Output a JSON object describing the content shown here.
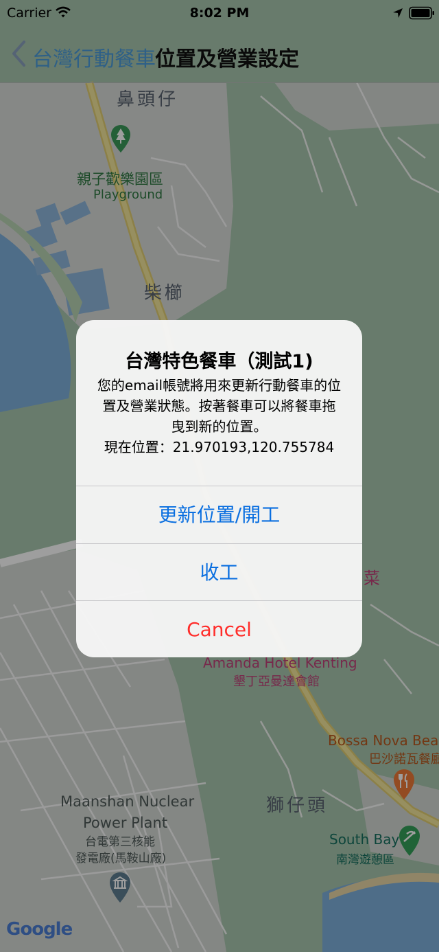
{
  "status_bar": {
    "carrier": "Carrier",
    "time": "8:02 PM"
  },
  "nav": {
    "back_label": "台灣行動餐車",
    "title": "位置及營業設定"
  },
  "map": {
    "labels": {
      "bitouzi": "鼻頭仔",
      "playground_zh": "親子歡樂園區",
      "playground_en": "Playground",
      "chaizhi": "柴櫛",
      "cai": "菜",
      "amanda_en": "Amanda Hotel Kenting",
      "amanda_zh": "墾丁亞曼達會館",
      "bossa_en": "Bossa Nova Beac",
      "bossa_zh": "巴沙諾瓦餐廳",
      "shizitou": "獅仔頭",
      "maanshan_en_1": "Maanshan Nuclear",
      "maanshan_en_2": "Power Plant",
      "maanshan_zh_1": "台電第三核能",
      "maanshan_zh_2": "發電廠(馬鞍山廠)",
      "southbay_en": "South Bay",
      "southbay_zh": "南灣遊憩區",
      "google_logo": "Google"
    },
    "colors": {
      "land_green": "#a9c7ae",
      "land_gray": "#d9dcd9",
      "water": "#7fb0dc",
      "road_yellow": "#f0e08a"
    }
  },
  "alert": {
    "title": "台灣特色餐車（測試1)",
    "message_line1": "您的email帳號將用來更新行動餐車的位",
    "message_line2": "置及營業狀態。按著餐車可以將餐車拖",
    "message_line3": "曳到新的位置。",
    "message_line4": "現在位置：21.970193,120.755784",
    "buttons": {
      "update": "更新位置/開工",
      "close": "收工",
      "cancel": "Cancel"
    }
  }
}
